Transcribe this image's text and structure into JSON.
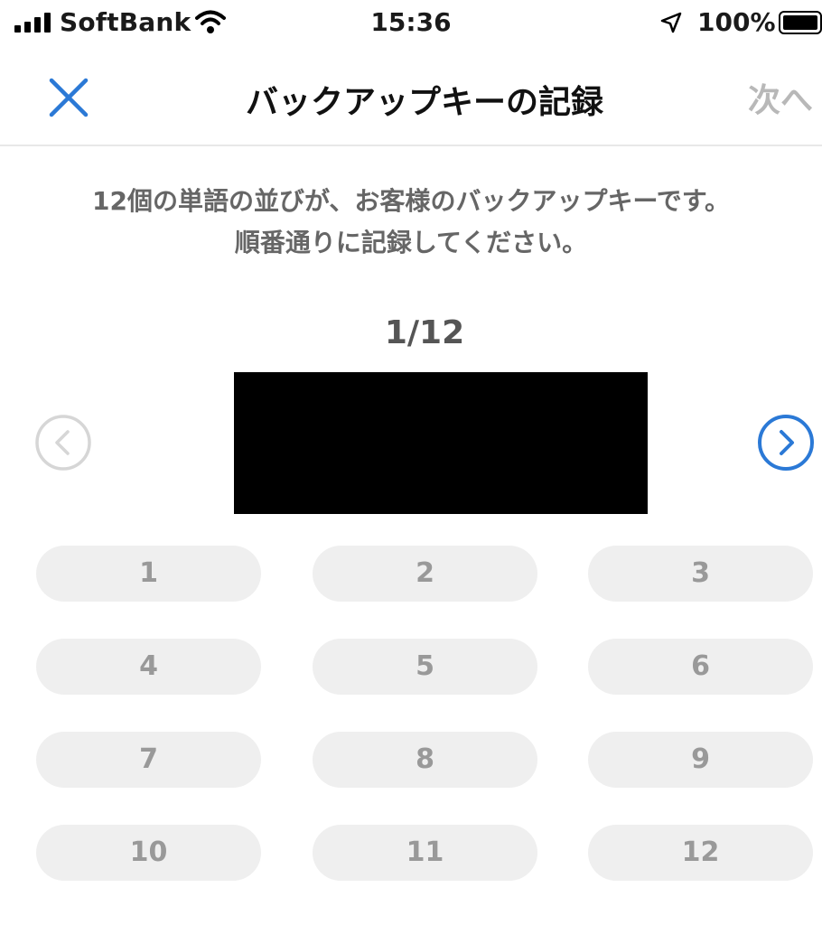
{
  "status_bar": {
    "carrier": "SoftBank",
    "time": "15:36",
    "battery": "100%",
    "battery_level": 1.0
  },
  "nav": {
    "title": "バックアップキーの記録",
    "close_icon": "close-icon",
    "next_label": "次へ"
  },
  "description": {
    "line1": "12個の単語の並びが、お客様のバックアップキーです。",
    "line2": "順番通りに記録してください。"
  },
  "word_card": {
    "counter": "1/12",
    "prev_icon": "chevron-left-circle-icon",
    "next_icon": "chevron-right-circle-icon"
  },
  "slots": [
    "1",
    "2",
    "3",
    "4",
    "5",
    "6",
    "7",
    "8",
    "9",
    "10",
    "11",
    "12"
  ],
  "colors": {
    "accent": "#2b79d6",
    "disabled": "#d6d6d6",
    "pill_bg": "#efefef",
    "pill_text": "#999999"
  }
}
